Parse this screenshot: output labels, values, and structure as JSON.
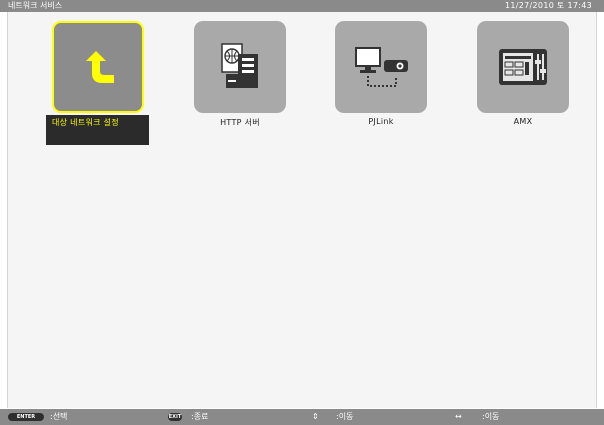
{
  "window": {
    "title": "네트워크 서비스",
    "clock": "11/27/2010 토 17:43"
  },
  "items": [
    {
      "label": "대상 네트워크 설정",
      "icon": "return-arrow-icon",
      "selected": true
    },
    {
      "label": "HTTP 서버",
      "icon": "http-server-icon",
      "selected": false
    },
    {
      "label": "PJLink",
      "icon": "pjlink-icon",
      "selected": false
    },
    {
      "label": "AMX",
      "icon": "amx-panel-icon",
      "selected": false
    }
  ],
  "footer": {
    "enter_key": "ENTER",
    "enter_hint": ":선택",
    "exit_key": "EXIT",
    "exit_hint": ":종료",
    "updown_symbol": "⇕",
    "updown_hint": ":이동",
    "leftright_symbol": "↔",
    "leftright_hint": ":이동"
  },
  "colors": {
    "selection": "#ffff00",
    "tile": "#a9a9a9",
    "bars": "#8a8a8a"
  }
}
